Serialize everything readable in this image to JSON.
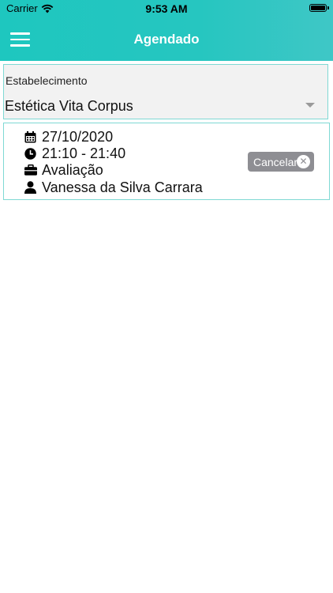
{
  "status_bar": {
    "carrier": "Carrier",
    "time": "9:53 AM"
  },
  "header": {
    "title": "Agendado",
    "menu_icon": "hamburger-menu-icon",
    "bg_color": "#26c6c0"
  },
  "establishment": {
    "label": "Estabelecimento",
    "selected": "Estética Vita Corpus"
  },
  "appointment": {
    "date": "27/10/2020",
    "time": "21:10 - 21:40",
    "service": "Avaliação",
    "professional": "Vanessa da Silva Carrara",
    "cancel_label": "Cancelar",
    "icons": [
      "calendar-icon",
      "clock-icon",
      "briefcase-icon",
      "user-icon"
    ]
  }
}
